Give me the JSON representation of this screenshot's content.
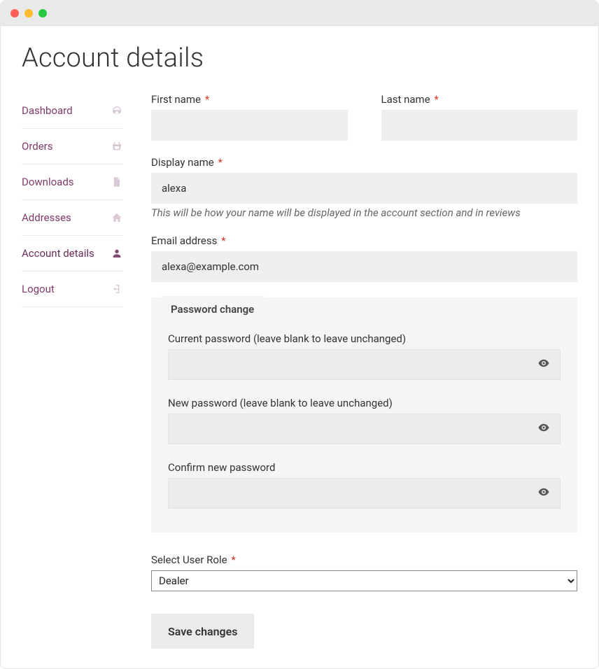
{
  "page": {
    "title": "Account details"
  },
  "sidebar": {
    "items": [
      {
        "label": "Dashboard",
        "icon": "dashboard-icon",
        "active": false
      },
      {
        "label": "Orders",
        "icon": "basket-icon",
        "active": false
      },
      {
        "label": "Downloads",
        "icon": "file-icon",
        "active": false
      },
      {
        "label": "Addresses",
        "icon": "home-icon",
        "active": false
      },
      {
        "label": "Account details",
        "icon": "user-icon",
        "active": true
      },
      {
        "label": "Logout",
        "icon": "logout-icon",
        "active": false
      }
    ]
  },
  "form": {
    "first_name": {
      "label": "First name",
      "value": "",
      "required": true
    },
    "last_name": {
      "label": "Last name",
      "value": "",
      "required": true
    },
    "display_name": {
      "label": "Display name",
      "value": "alexa",
      "required": true,
      "hint": "This will be how your name will be displayed in the account section and in reviews"
    },
    "email": {
      "label": "Email address",
      "value": "alexa@example.com",
      "required": true
    },
    "password_section": {
      "legend": "Password change",
      "current": {
        "label": "Current password (leave blank to leave unchanged)",
        "value": ""
      },
      "new": {
        "label": "New password (leave blank to leave unchanged)",
        "value": ""
      },
      "confirm": {
        "label": "Confirm new password",
        "value": ""
      }
    },
    "role": {
      "label": "Select User Role",
      "required": true,
      "selected": "Dealer",
      "options": [
        "Dealer"
      ]
    },
    "submit_label": "Save changes",
    "required_marker": "*"
  }
}
